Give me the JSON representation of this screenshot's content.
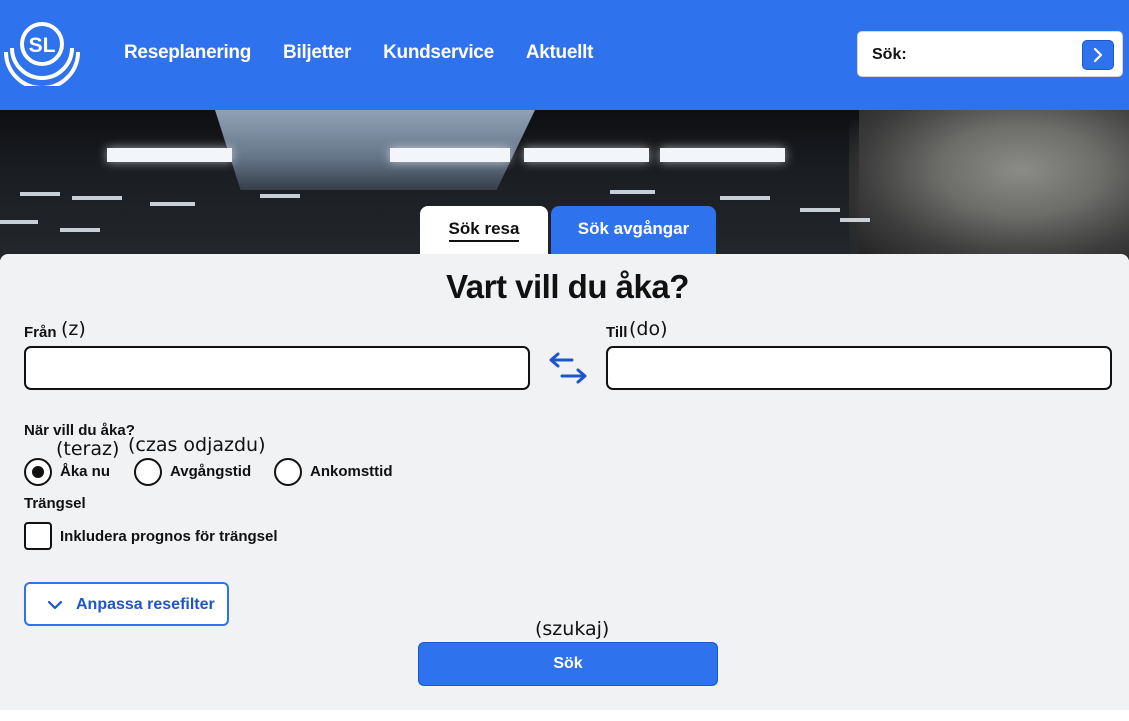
{
  "header": {
    "logo_text": "SL",
    "nav": [
      "Reseplanering",
      "Biljetter",
      "Kundservice",
      "Aktuellt"
    ],
    "search": {
      "label": "Sök:",
      "value": ""
    }
  },
  "tabs": {
    "active": "Sök resa",
    "inactive": "Sök avgångar"
  },
  "form": {
    "heading": "Vart vill du åka?",
    "from": {
      "label": "Från",
      "note": "(z)",
      "value": ""
    },
    "to": {
      "label": "Till",
      "note": "(do)",
      "value": ""
    },
    "when": {
      "label": "När vill du åka?",
      "options": [
        {
          "label": "Åka nu",
          "note": "(teraz)",
          "selected": true
        },
        {
          "label": "Avgångstid",
          "note": "(czas odjazdu)",
          "selected": false
        },
        {
          "label": "Ankomsttid",
          "selected": false
        }
      ]
    },
    "crowding": {
      "label": "Trängsel",
      "checkbox_label": "Inkludera prognos för trängsel",
      "checked": false
    },
    "filter_button": "Anpassa resefilter",
    "submit": {
      "label": "Sök",
      "note": "(szukaj)"
    }
  },
  "colors": {
    "brand_blue": "#2f72ee",
    "panel_bg": "#f0f2f4",
    "text": "#111111"
  }
}
